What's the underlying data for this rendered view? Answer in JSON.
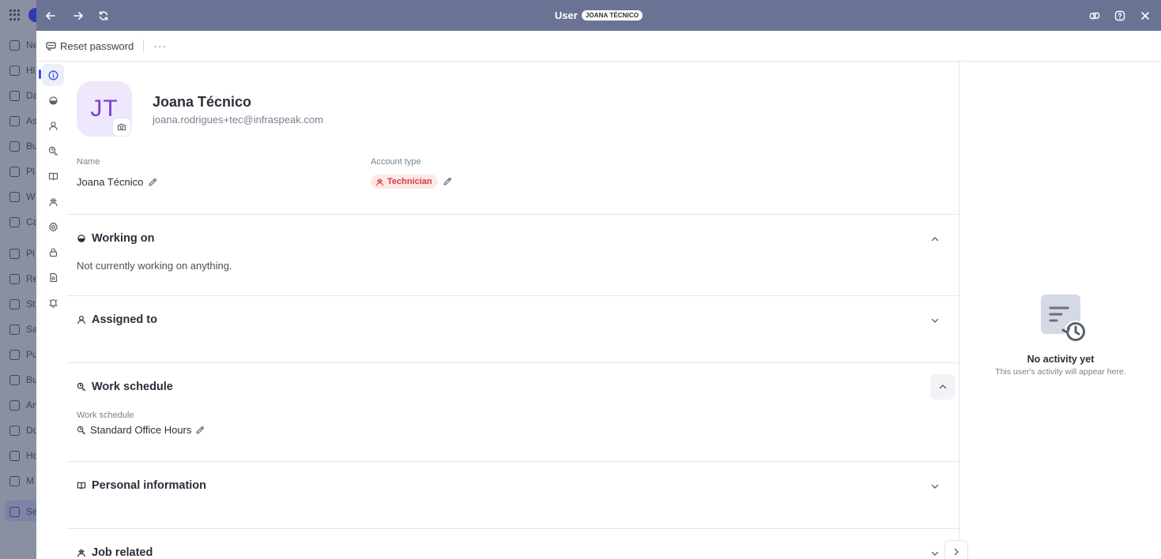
{
  "background_app": {
    "sidebar_items": [
      "Ne",
      "Hi",
      "Da",
      "As",
      "Bu",
      "Pl",
      "W",
      "Ca",
      "Pl",
      "Re",
      "St",
      "Sa",
      "Pu",
      "Bu",
      "An",
      "Do",
      "Ho",
      "M",
      "Se"
    ]
  },
  "topbar": {
    "title": "User",
    "badge": "JOANA TÉCNICO"
  },
  "toolbar": {
    "reset_password_label": "Reset password",
    "more_label": "···"
  },
  "profile": {
    "initials": "JT",
    "name": "Joana Técnico",
    "email": "joana.rodrigues+tec@infraspeak.com",
    "name_label": "Name",
    "name_value": "Joana Técnico",
    "account_type_label": "Account type",
    "account_type_value": "Technician"
  },
  "sections": {
    "working_on": {
      "title": "Working on",
      "empty_text": "Not currently working on anything."
    },
    "assigned_to": {
      "title": "Assigned to"
    },
    "work_schedule": {
      "title": "Work schedule",
      "field_label": "Work schedule",
      "field_value": "Standard Office Hours"
    },
    "personal_information": {
      "title": "Personal information"
    },
    "job_related": {
      "title": "Job related"
    }
  },
  "activity": {
    "empty_title": "No activity yet",
    "empty_subtitle": "This user's activity will appear here."
  },
  "colors": {
    "topbar": "#6b7394",
    "accent": "#3b4de0",
    "avatar_bg": "#efe7fb",
    "avatar_text": "#7b3fd1",
    "technician_badge_bg": "#fde8e8",
    "technician_badge_text": "#d63a3a"
  }
}
